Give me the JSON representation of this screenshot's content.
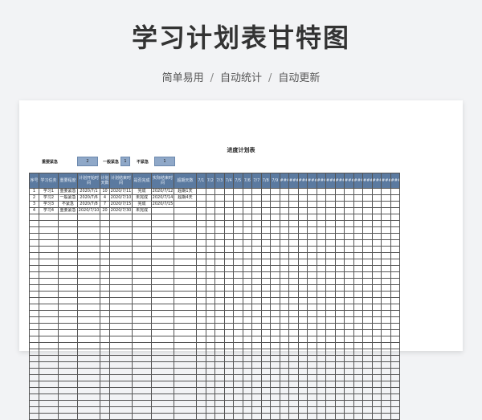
{
  "hero": {
    "title": "学习计划表甘特图",
    "subtitle_parts": [
      "简单易用",
      "自动统计",
      "自动更新"
    ],
    "separator": "/"
  },
  "sheet": {
    "title": "进度计划表",
    "legend": [
      {
        "label": "重要紧急",
        "value": "2"
      },
      {
        "label": "一般紧急",
        "value": "1"
      },
      {
        "label": "不紧急",
        "value": "1"
      }
    ],
    "columns": [
      "序号",
      "学习任务",
      "重要程度",
      "计划开始时间",
      "计划天数",
      "计划结束时间",
      "是否完成",
      "实际结束时间",
      "超期天数"
    ],
    "date_columns": [
      "7/1",
      "7/2",
      "7/3",
      "7/4",
      "7/5",
      "7/6",
      "7/7",
      "7/8",
      "7/9",
      "###",
      "###",
      "###",
      "###",
      "###",
      "###",
      "###",
      "###",
      "###",
      "###",
      "###",
      "###",
      "###"
    ],
    "rows": [
      [
        "1",
        "学习1",
        "重要紧急",
        "2020/7/1",
        "10",
        "2020/7/11",
        "完成",
        "2020/7/12",
        "超期1天"
      ],
      [
        "2",
        "学习2",
        "一般紧急",
        "2020/7/6",
        "4",
        "2020/7/10",
        "未完成",
        "2020/7/14",
        "超期4天"
      ],
      [
        "3",
        "学习3",
        "不紧急",
        "2020/7/8",
        "7",
        "2020/7/15",
        "完成",
        "2020/7/15",
        ""
      ],
      [
        "4",
        "学习4",
        "重要紧急",
        "2020/7/10",
        "20",
        "2020/7/30",
        "未完成",
        "",
        ""
      ]
    ],
    "blank_rows": 32
  }
}
